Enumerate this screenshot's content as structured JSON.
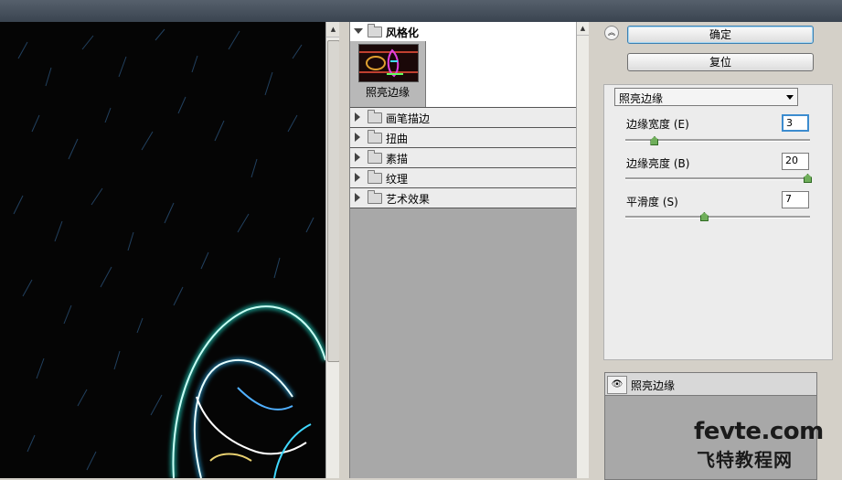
{
  "gallery": {
    "open_category": "风格化",
    "thumbnail_label": "照亮边缘",
    "categories": [
      "画笔描边",
      "扭曲",
      "素描",
      "纹理",
      "艺术效果"
    ]
  },
  "buttons": {
    "ok": "确定",
    "reset": "复位"
  },
  "filter_select": {
    "value": "照亮边缘"
  },
  "params": [
    {
      "label": "边缘宽度 (E)",
      "value": "3",
      "min": 1,
      "max": 14
    },
    {
      "label": "边缘亮度 (B)",
      "value": "20",
      "min": 0,
      "max": 20
    },
    {
      "label": "平滑度 (S)",
      "value": "7",
      "min": 1,
      "max": 15
    }
  ],
  "layers": {
    "item": "照亮边缘"
  },
  "watermark": {
    "line1": "fevte.com",
    "line2": "飞特教程网"
  },
  "icons": {
    "collapse": "double-chevron-up-icon",
    "eye": "eye-icon",
    "folder": "folder-icon"
  }
}
